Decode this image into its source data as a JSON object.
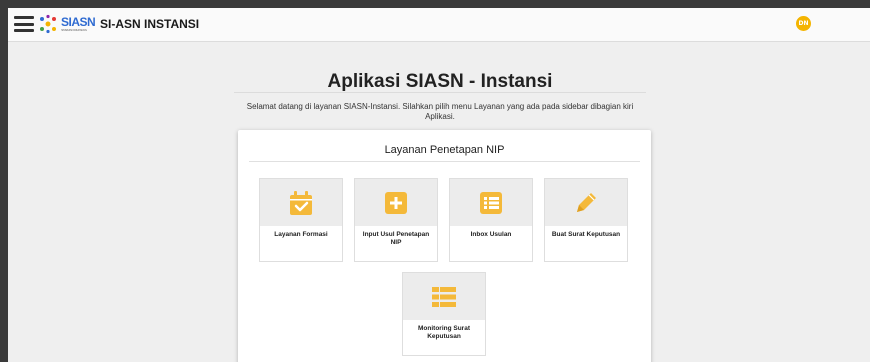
{
  "header": {
    "brand_logo_text": "SIASN",
    "brand_tagline": "SISTEM INFORMASI ASN",
    "app_title": "SI-ASN INSTANSI",
    "user_initials": "DN"
  },
  "main": {
    "title": "Aplikasi SIASN - Instansi",
    "welcome_line1": "Selamat datang di layanan SIASN-Instansi. Silahkan pilih menu Layanan yang ada pada sidebar dibagian kiri",
    "welcome_line2": "Aplikasi."
  },
  "card": {
    "title": "Layanan Penetapan NIP",
    "tiles": [
      {
        "label": "Layanan Formasi",
        "icon": "calendar-check-icon"
      },
      {
        "label": "Input Usul Penetapan NIP",
        "icon": "plus-square-icon"
      },
      {
        "label": "Inbox Usulan",
        "icon": "list-icon"
      },
      {
        "label": "Buat Surat Keputusan",
        "icon": "pencil-icon"
      },
      {
        "label": "Monitoring Surat Keputusan",
        "icon": "table-list-icon"
      }
    ]
  },
  "colors": {
    "accent_icon": "#f4b93a",
    "brand_blue": "#2f6bd1",
    "avatar_bg": "#f4b400"
  }
}
